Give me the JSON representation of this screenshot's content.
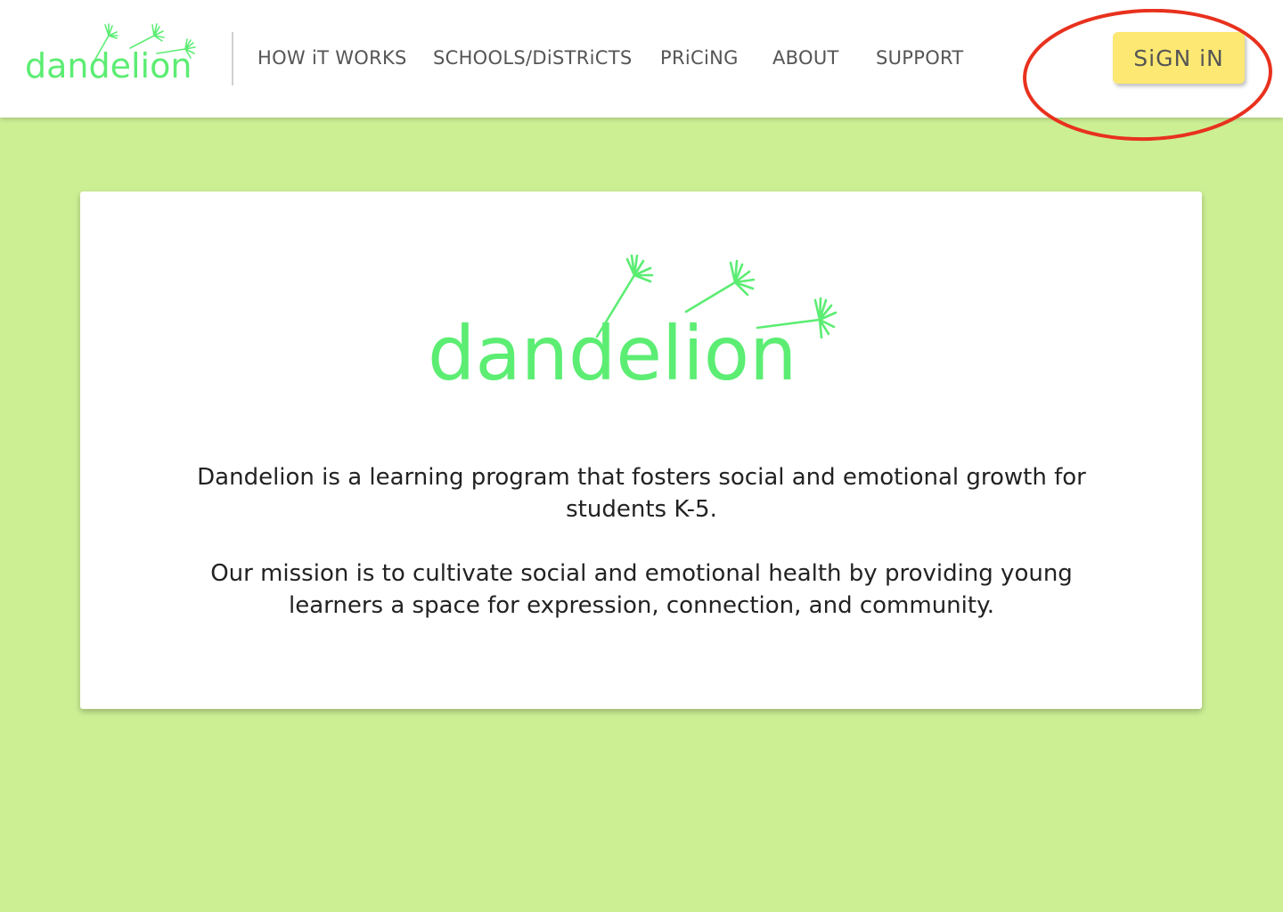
{
  "brand": {
    "name": "dandelion"
  },
  "nav": {
    "items": [
      {
        "label": "HOW iT WORKS"
      },
      {
        "label": "SCHOOLS/DiSTRiCTS"
      },
      {
        "label": "PRiCiNG"
      },
      {
        "label": "ABOUT"
      },
      {
        "label": "SUPPORT"
      }
    ],
    "signin_label": "SiGN iN"
  },
  "hero": {
    "logo_text": "dandelion",
    "paragraph_1": "Dandelion is a learning program that fosters social and emotional growth for students K-5.",
    "paragraph_2": "Our mission is to cultivate social and emotional health by providing young learners a space for expression, connection, and community."
  },
  "colors": {
    "page_background": "#ccef94",
    "brand_green": "#5ced73",
    "signin_yellow": "#fce872",
    "highlight_red": "#e8311e",
    "nav_text": "#555555"
  },
  "icons": {
    "seeds": "dandelion-seeds-icon",
    "highlight": "red-circle-annotation"
  }
}
